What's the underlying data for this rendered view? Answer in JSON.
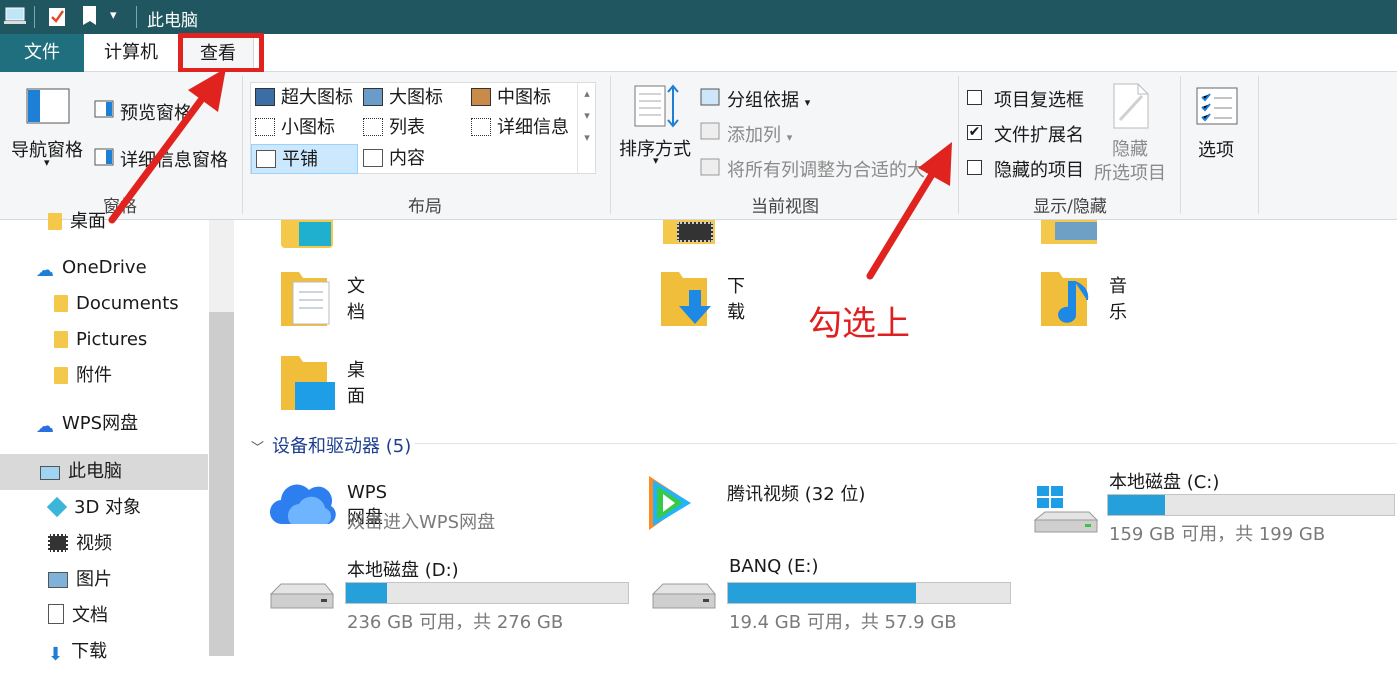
{
  "window": {
    "title": "此电脑"
  },
  "tabs": {
    "file": "文件",
    "computer": "计算机",
    "view": "查看"
  },
  "ribbon": {
    "pane": {
      "nav": "导航窗格",
      "preview": "预览窗格",
      "details": "详细信息窗格",
      "label": "窗格"
    },
    "layout": {
      "items": [
        "超大图标",
        "大图标",
        "中图标",
        "小图标",
        "列表",
        "详细信息",
        "平铺",
        "内容"
      ],
      "label": "布局"
    },
    "current": {
      "sort": "排序方式",
      "group": "分组依据",
      "add_col": "添加列",
      "fit": "将所有列调整为合适的大小",
      "label": "当前视图"
    },
    "show": {
      "checkboxes": "项目复选框",
      "extensions": "文件扩展名",
      "hidden": "隐藏的项目",
      "hide_sel_1": "隐藏",
      "hide_sel_2": "所选项目",
      "label": "显示/隐藏",
      "checked": [
        false,
        true,
        false
      ]
    },
    "options": "选项"
  },
  "sidebar": {
    "items": [
      "桌面",
      "OneDrive",
      "Documents",
      "Pictures",
      "附件",
      "WPS网盘",
      "此电脑",
      "3D 对象",
      "视频",
      "图片",
      "文档",
      "下载"
    ]
  },
  "folders": [
    "文档",
    "下载",
    "音乐",
    "桌面"
  ],
  "devices": {
    "header": "设备和驱动器 (5)",
    "items": [
      {
        "name": "WPS网盘",
        "sub": "双击进入WPS网盘"
      },
      {
        "name": "腾讯视频 (32 位)"
      },
      {
        "name": "本地磁盘 (C:)",
        "sub": "159 GB 可用，共 199 GB",
        "used": 0.2
      },
      {
        "name": "本地磁盘 (D:)",
        "sub": "236 GB 可用，共 276 GB",
        "used": 0.145
      },
      {
        "name": "BANQ (E:)",
        "sub": "19.4 GB 可用，共 57.9 GB",
        "used": 0.665
      }
    ]
  },
  "annotation": {
    "text": "勾选上"
  },
  "colors": {
    "accent": "#26a0da",
    "red": "#e0231f",
    "title": "#1f5660"
  }
}
